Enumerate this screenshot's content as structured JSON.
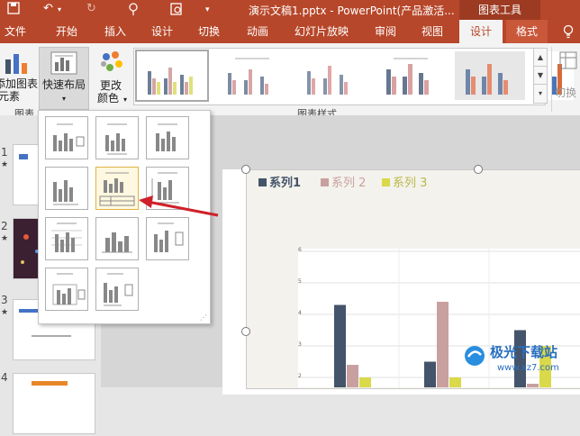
{
  "titlebar": {
    "document_title": "演示文稿1.pptx - PowerPoint(产品激活...",
    "context_group": "图表工具",
    "quick_access": [
      "save-icon",
      "undo-icon",
      "redo-icon",
      "presenter-icon",
      "preview-icon"
    ]
  },
  "tabs": [
    {
      "label": "文件",
      "active": false
    },
    {
      "label": "开始",
      "active": false
    },
    {
      "label": "插入",
      "active": false
    },
    {
      "label": "设计",
      "active": false
    },
    {
      "label": "切换",
      "active": false
    },
    {
      "label": "动画",
      "active": false
    },
    {
      "label": "幻灯片放映",
      "active": false
    },
    {
      "label": "审阅",
      "active": false
    },
    {
      "label": "视图",
      "active": false
    },
    {
      "label": "设计",
      "active": true
    },
    {
      "label": "格式",
      "active": false
    }
  ],
  "help_icon": "lightbulb-icon",
  "ribbon": {
    "add_element_line1": "添加图表",
    "add_element_line2": "元素",
    "quick_layout": "快速布局",
    "change_colors_line1": "更改",
    "change_colors_line2": "颜色",
    "group_chart_layouts": "图表",
    "group_chart_styles": "图表样式",
    "switch_label": "切换"
  },
  "slides": [
    {
      "number": "1",
      "starred": true
    },
    {
      "number": "2",
      "starred": true
    },
    {
      "number": "3",
      "starred": true
    },
    {
      "number": "4",
      "starred": false
    }
  ],
  "chart": {
    "legend": [
      {
        "label": "系列1",
        "color": "#44546a"
      },
      {
        "label": "系列 2",
        "color": "#c9a0a0"
      },
      {
        "label": "系列 3",
        "color": "#d9d94a"
      }
    ],
    "y_ticks": [
      "6",
      "5",
      "4",
      "3",
      "2"
    ]
  },
  "chart_data": {
    "type": "bar",
    "series": [
      {
        "name": "系列1",
        "values": [
          4.3,
          2.5,
          3.5
        ]
      },
      {
        "name": "系列 2",
        "values": [
          2.4,
          4.4,
          1.8
        ]
      },
      {
        "name": "系列 3",
        "values": [
          2.0,
          2.0,
          3.0
        ]
      }
    ],
    "ylim": [
      0,
      6
    ],
    "grid": true,
    "legend_position": "top-left"
  },
  "colors": {
    "accent": "#b7472a",
    "ribbon_bg": "#f3f3f3",
    "annotation_arrow": "#d0202a"
  },
  "watermark": {
    "name": "极光下载站",
    "url": "www.xz7.com"
  }
}
